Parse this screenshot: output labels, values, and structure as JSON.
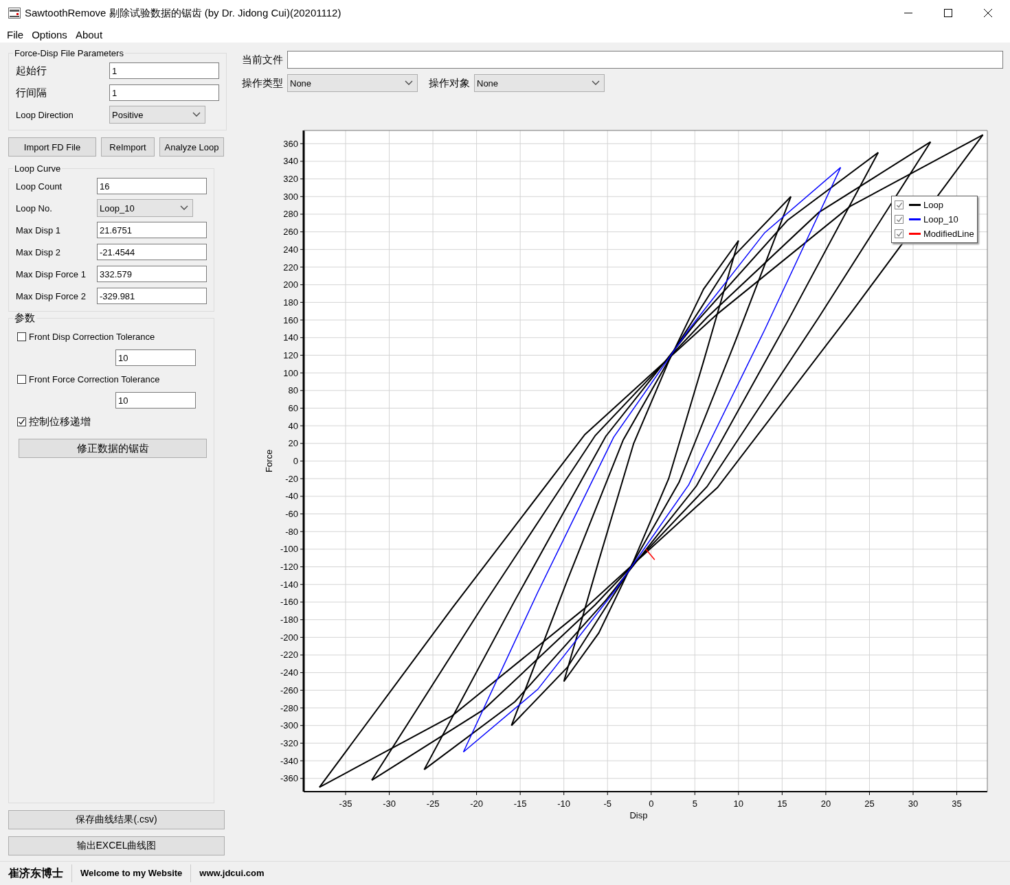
{
  "window": {
    "title": "SawtoothRemove 剔除试验数据的锯齿 (by Dr. Jidong Cui)(20201112)"
  },
  "menu": [
    "File",
    "Options",
    "About"
  ],
  "file_params": {
    "title": "Force-Disp File Parameters",
    "fields": [
      {
        "kind": "input",
        "label": "起始行",
        "value": "1"
      },
      {
        "kind": "input",
        "label": "行间隔",
        "value": "1"
      },
      {
        "kind": "select",
        "label": "Loop Direction",
        "value": "Positive"
      }
    ]
  },
  "buttons": [
    "Import FD File",
    "ReImport",
    "Analyze Loop"
  ],
  "loop_curve": {
    "title": "Loop Curve",
    "fields": [
      {
        "kind": "input",
        "label": "Loop Count",
        "value": "16"
      },
      {
        "kind": "select",
        "label": "Loop No.",
        "value": "Loop_10"
      },
      {
        "kind": "input",
        "label": "Max Disp 1",
        "value": "21.6751"
      },
      {
        "kind": "input",
        "label": "Max Disp 2",
        "value": "-21.4544"
      },
      {
        "kind": "input",
        "label": "Max Disp Force 1",
        "value": "332.579"
      },
      {
        "kind": "input",
        "label": "Max Disp Force 2",
        "value": "-329.981"
      }
    ]
  },
  "params": {
    "title": "参数",
    "items": [
      {
        "kind": "checkbox",
        "label": "Front Disp Correction Tolerance",
        "checked": false
      },
      {
        "kind": "input",
        "value": "10"
      },
      {
        "kind": "checkbox",
        "label": "Front Force Correction Tolerance",
        "checked": false
      },
      {
        "kind": "input",
        "value": "10"
      },
      {
        "kind": "checkbox",
        "label": "控制位移递增",
        "checked": true
      },
      {
        "kind": "button",
        "label": "修正数据的锯齿"
      }
    ]
  },
  "bottom_buttons": [
    "保存曲线结果(.csv)",
    "输出EXCEL曲线图"
  ],
  "current_file": {
    "label": "当前文件"
  },
  "operation": [
    {
      "label": "操作类型",
      "value": "None"
    },
    {
      "label": "操作对象",
      "value": "None"
    }
  ],
  "chart": {
    "chart_data": {
      "type": "line",
      "grid": true,
      "legend": true,
      "xlabel": "Disp",
      "ylabel": "Force",
      "xlim": [
        -39.8,
        38.5
      ],
      "ylim": [
        -375,
        375
      ],
      "xticks": [
        -35,
        -30,
        -25,
        -20,
        -15,
        -10,
        -5,
        0,
        5,
        10,
        15,
        20,
        25,
        30,
        35
      ],
      "yticks": [
        -360,
        -340,
        -320,
        -300,
        -280,
        -260,
        -240,
        -220,
        -200,
        -180,
        -160,
        -140,
        -120,
        -100,
        -80,
        -60,
        -40,
        -20,
        0,
        20,
        40,
        60,
        80,
        100,
        120,
        140,
        160,
        180,
        200,
        220,
        240,
        260,
        280,
        300,
        320,
        340,
        360
      ],
      "series": [
        {
          "name": "Loop",
          "color": "#000000",
          "x": [
            38,
            22.8,
            7.6,
            -7.6,
            -22.8,
            -38,
            null,
            -38,
            -22.8,
            -7.6,
            7.6,
            22.8,
            38,
            null,
            32,
            19.2,
            6.4,
            -6.4,
            -19.2,
            -32,
            null,
            -32,
            -19.2,
            -6.4,
            6.4,
            19.2,
            32,
            null,
            26,
            15.6,
            5.2,
            -5.2,
            -15.6,
            -26,
            null,
            -26,
            -15.6,
            -5.2,
            5.2,
            15.6,
            26,
            null,
            16,
            9.6,
            3.2,
            -3.2,
            -9.6,
            -16,
            null,
            -16,
            -9.6,
            -3.2,
            3.2,
            9.6,
            16,
            null,
            10,
            6,
            2,
            -2,
            -6,
            -10,
            null,
            -10,
            -6,
            -2,
            2,
            6,
            10
          ],
          "values": [
            370,
            167,
            -30,
            -167,
            -289,
            -370,
            null,
            -370,
            -167,
            30,
            167,
            289,
            370,
            null,
            362,
            163,
            -29,
            -163,
            -282,
            -362,
            null,
            -362,
            -163,
            29,
            163,
            282,
            362,
            null,
            350,
            158,
            -28,
            -158,
            -273,
            -350,
            null,
            -350,
            -158,
            28,
            158,
            273,
            350,
            null,
            300,
            135,
            -24,
            -135,
            -234,
            -300,
            null,
            -300,
            -135,
            24,
            135,
            234,
            300,
            null,
            250,
            113,
            -20,
            -113,
            -195,
            -250,
            null,
            -250,
            -113,
            20,
            113,
            195,
            250
          ]
        },
        {
          "name": "Loop_10",
          "color": "#0000ff",
          "x": [
            21.7,
            13,
            4.3,
            -4.3,
            -13,
            -21.5,
            null,
            -21.5,
            -13,
            -4.3,
            4.3,
            13,
            21.7
          ],
          "values": [
            333,
            149,
            -27,
            -149,
            -259,
            -330,
            null,
            -330,
            -149,
            27,
            149,
            259,
            333
          ]
        },
        {
          "name": "ModifiedLine",
          "color": "#ff0000",
          "x": [
            -0.6,
            0.4
          ],
          "values": [
            -100,
            -112
          ]
        }
      ]
    },
    "legend_checks": [
      {
        "checked": true
      },
      {
        "checked": true
      },
      {
        "checked": true
      }
    ]
  },
  "status_bar": [
    "崔济东博士",
    "Welcome to my Website",
    "www.jdcui.com"
  ]
}
